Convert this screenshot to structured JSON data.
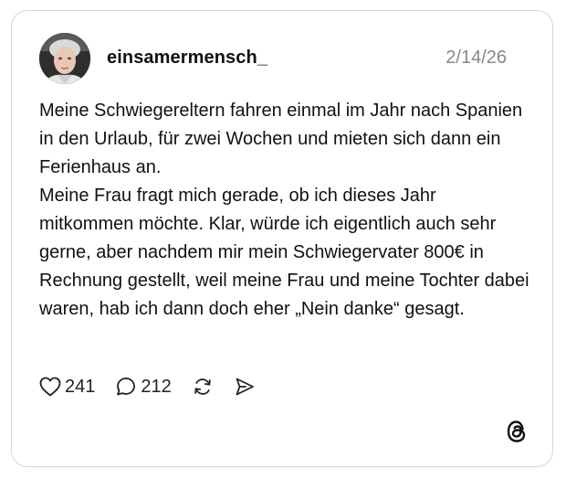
{
  "post": {
    "username": "einsamermensch_",
    "date": "2/14/26",
    "paragraphs": [
      "Meine Schwiegereltern fahren einmal im Jahr nach Spanien in den Urlaub, für zwei Wochen und mieten sich dann ein Ferienhaus an.",
      "Meine Frau fragt mich gerade, ob ich dieses Jahr mitkommen möchte. Klar, würde ich eigentlich auch sehr gerne, aber nachdem mir mein Schwiegervater 800€ in Rechnung gestellt, weil meine Frau und meine Tochter dabei waren, hab ich dann doch eher „Nein danke“ gesagt."
    ],
    "likes": "241",
    "replies": "212"
  },
  "icons": {
    "like": "heart-icon",
    "reply": "speech-bubble-icon",
    "repost": "repost-icon",
    "share": "send-icon",
    "brand": "threads-logo-icon"
  },
  "colors": {
    "border": "#d6d6d6",
    "text": "#111111",
    "muted": "#888888"
  }
}
